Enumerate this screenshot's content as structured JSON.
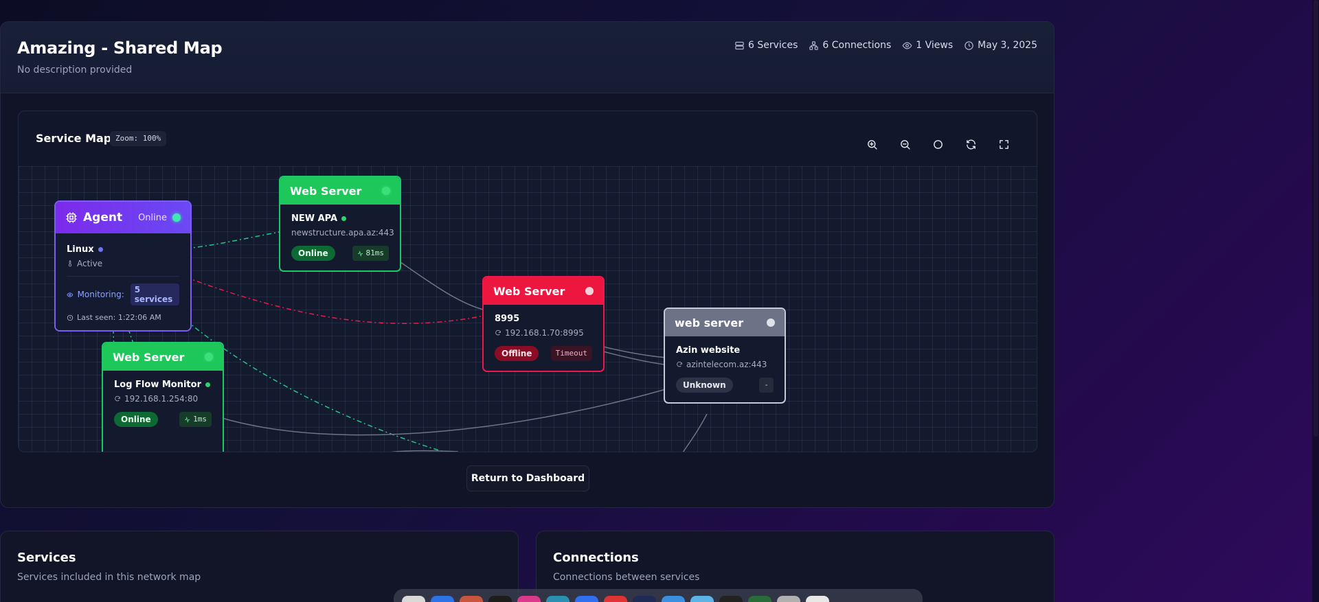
{
  "header": {
    "title": "Amazing - Shared Map",
    "description": "No description provided",
    "stats": {
      "services": "6 Services",
      "connections": "6 Connections",
      "views": "1 Views",
      "date": "May 3, 2025"
    }
  },
  "map": {
    "title": "Service Map",
    "zoom": "Zoom: 100%",
    "tools": [
      "zoom-in-icon",
      "zoom-out-icon",
      "reset-icon",
      "refresh-icon",
      "fullscreen-icon"
    ]
  },
  "nodes": {
    "agent": {
      "title": "Agent",
      "status": "Online",
      "name": "Linux",
      "state": "Active",
      "monitoring_label": "Monitoring:",
      "monitoring_count": "5 services",
      "last_seen": "Last seen: 1:22:06 AM"
    },
    "newapa": {
      "type": "Web Server",
      "name": "NEW APA",
      "address": "newstructure.apa.az:443",
      "status": "Online",
      "latency": "81ms"
    },
    "ip8995": {
      "type": "Web Server",
      "name": "8995",
      "address": "192.168.1.70:8995",
      "status": "Offline",
      "latency": "Timeout"
    },
    "azin": {
      "type": "web server",
      "name": "Azin website",
      "address": "azintelecom.az:443",
      "status": "Unknown",
      "latency": "-"
    },
    "logflow": {
      "type": "Web Server",
      "name": "Log Flow Monitor",
      "address": "192.168.1.254:80",
      "status": "Online",
      "latency": "1ms"
    }
  },
  "colors": {
    "online": "#1ec75a",
    "offline": "#ec163f",
    "unknown": "#6d7387",
    "agent": "#7b2bea"
  },
  "actions": {
    "return": "Return to Dashboard"
  },
  "sections": {
    "services": {
      "title": "Services",
      "subtitle": "Services included in this network map"
    },
    "connections": {
      "title": "Connections",
      "subtitle": "Connections between services"
    }
  }
}
